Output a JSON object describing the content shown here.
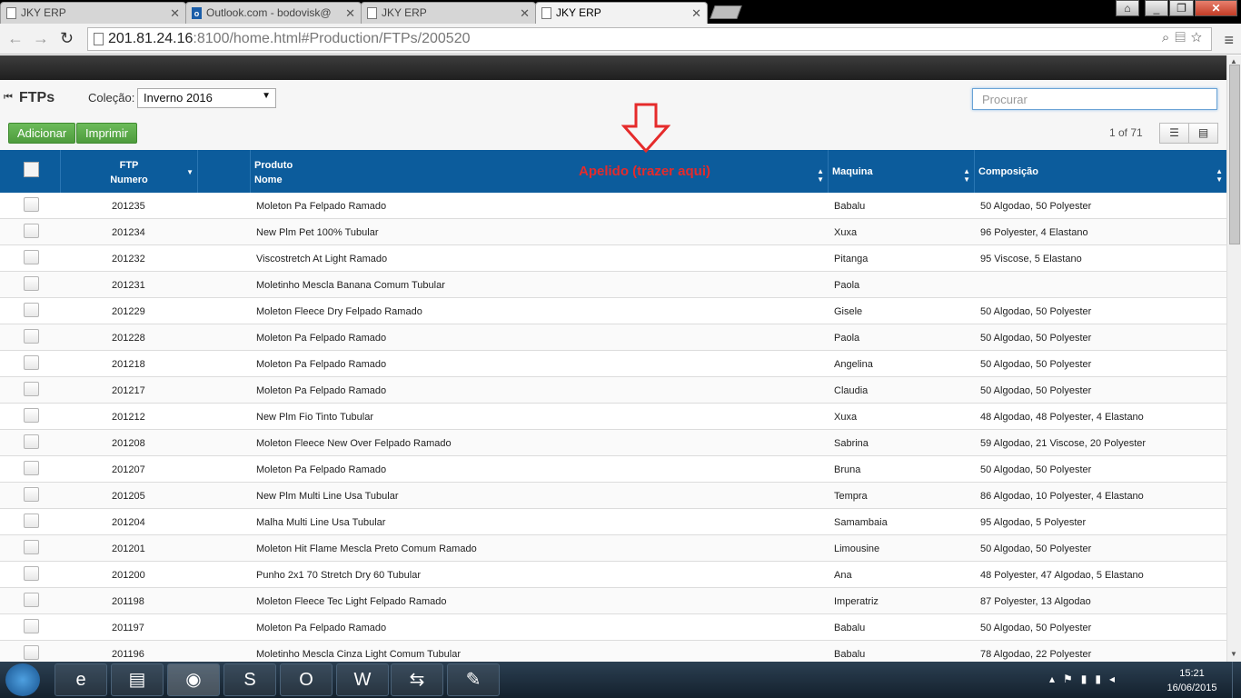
{
  "browser": {
    "tabs": [
      {
        "title": "JKY ERP",
        "icon": "page-icon"
      },
      {
        "title": "Outlook.com - bodovisk@",
        "icon": "outlook-icon"
      },
      {
        "title": "JKY ERP",
        "icon": "page-icon"
      },
      {
        "title": "JKY ERP",
        "icon": "page-icon"
      }
    ],
    "url_host": "201.81.24.16",
    "url_rest": ":8100/home.html#Production/FTPs/200520"
  },
  "header": {
    "title": "FTPs",
    "colecao_label": "Coleção:",
    "colecao_value": "Inverno 2016",
    "search_placeholder": "Procurar",
    "add_label": "Adicionar",
    "print_label": "Imprimir",
    "pager": "1 of 71"
  },
  "table": {
    "columns": {
      "ftp_line1": "FTP",
      "ftp_line2": "Numero",
      "produto_line1": "Produto",
      "produto_line2": "Nome",
      "maquina": "Maquina",
      "composicao": "Composição"
    },
    "rows": [
      {
        "numero": "201235",
        "produto": "Moleton Pa Felpado Ramado",
        "maquina": "Babalu",
        "composicao": "50 Algodao, 50 Polyester"
      },
      {
        "numero": "201234",
        "produto": "New Plm Pet 100% Tubular",
        "maquina": "Xuxa",
        "composicao": "96 Polyester, 4 Elastano"
      },
      {
        "numero": "201232",
        "produto": "Viscostretch At Light Ramado",
        "maquina": "Pitanga",
        "composicao": "95 Viscose, 5 Elastano"
      },
      {
        "numero": "201231",
        "produto": "Moletinho Mescla Banana Comum Tubular",
        "maquina": "Paola",
        "composicao": ""
      },
      {
        "numero": "201229",
        "produto": "Moleton Fleece Dry Felpado Ramado",
        "maquina": "Gisele",
        "composicao": "50 Algodao, 50 Polyester"
      },
      {
        "numero": "201228",
        "produto": "Moleton Pa Felpado Ramado",
        "maquina": "Paola",
        "composicao": "50 Algodao, 50 Polyester"
      },
      {
        "numero": "201218",
        "produto": "Moleton Pa Felpado Ramado",
        "maquina": "Angelina",
        "composicao": "50 Algodao, 50 Polyester"
      },
      {
        "numero": "201217",
        "produto": "Moleton Pa Felpado Ramado",
        "maquina": "Claudia",
        "composicao": "50 Algodao, 50 Polyester"
      },
      {
        "numero": "201212",
        "produto": "New Plm Fio Tinto Tubular",
        "maquina": "Xuxa",
        "composicao": "48 Algodao, 48 Polyester, 4 Elastano"
      },
      {
        "numero": "201208",
        "produto": "Moleton Fleece New Over Felpado Ramado",
        "maquina": "Sabrina",
        "composicao": "59 Algodao, 21 Viscose, 20 Polyester"
      },
      {
        "numero": "201207",
        "produto": "Moleton Pa Felpado Ramado",
        "maquina": "Bruna",
        "composicao": "50 Algodao, 50 Polyester"
      },
      {
        "numero": "201205",
        "produto": "New Plm Multi Line Usa Tubular",
        "maquina": "Tempra",
        "composicao": "86 Algodao, 10 Polyester, 4 Elastano"
      },
      {
        "numero": "201204",
        "produto": "Malha Multi Line Usa Tubular",
        "maquina": "Samambaia",
        "composicao": "95 Algodao, 5 Polyester"
      },
      {
        "numero": "201201",
        "produto": "Moleton Hit Flame Mescla Preto Comum Ramado",
        "maquina": "Limousine",
        "composicao": "50 Algodao, 50 Polyester"
      },
      {
        "numero": "201200",
        "produto": "Punho 2x1 70 Stretch Dry 60 Tubular",
        "maquina": "Ana",
        "composicao": "48 Polyester, 47 Algodao, 5 Elastano"
      },
      {
        "numero": "201198",
        "produto": "Moleton Fleece Tec Light Felpado Ramado",
        "maquina": "Imperatriz",
        "composicao": "87 Polyester, 13 Algodao"
      },
      {
        "numero": "201197",
        "produto": "Moleton Pa Felpado Ramado",
        "maquina": "Babalu",
        "composicao": "50 Algodao, 50 Polyester"
      },
      {
        "numero": "201196",
        "produto": "Moletinho Mescla Cinza Light Comum Tubular",
        "maquina": "Babalu",
        "composicao": "78 Algodao, 22 Polyester"
      }
    ]
  },
  "annotation": {
    "text": "Apelido (trazer aqui)",
    "color": "#e52b2b"
  },
  "taskbar": {
    "apps": [
      "ie-icon",
      "explorer-icon",
      "chrome-icon",
      "skype-icon",
      "outlook-icon",
      "word-icon",
      "teamviewer-icon",
      "paint-icon"
    ],
    "time": "15:21",
    "date": "16/06/2015"
  },
  "colors": {
    "header_blue": "#0c5c9c",
    "button_green": "#4e9c3d"
  }
}
